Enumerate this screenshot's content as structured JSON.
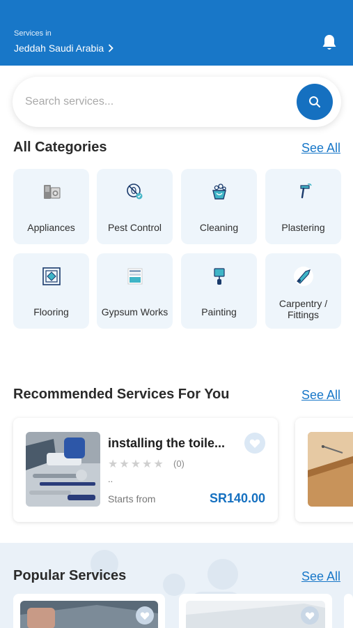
{
  "header": {
    "services_in_label": "Services in",
    "location": "Jeddah Saudi Arabia",
    "bell_icon": "bell-icon"
  },
  "search": {
    "placeholder": "Search services...",
    "button_icon": "search-icon"
  },
  "categories": {
    "title": "All Categories",
    "see_all": "See All",
    "items": [
      {
        "label": "Appliances",
        "icon": "appliances-icon"
      },
      {
        "label": "Pest Control",
        "icon": "pest-control-icon"
      },
      {
        "label": "Cleaning",
        "icon": "cleaning-icon"
      },
      {
        "label": "Plastering",
        "icon": "plastering-icon"
      },
      {
        "label": "Flooring",
        "icon": "flooring-icon"
      },
      {
        "label": "Gypsum Works",
        "icon": "gypsum-icon"
      },
      {
        "label": "Painting",
        "icon": "painting-icon"
      },
      {
        "label": "Carpentry / Fittings",
        "icon": "carpentry-icon"
      }
    ]
  },
  "recommended": {
    "title": "Recommended Services For You",
    "see_all": "See All",
    "cards": [
      {
        "title": "installing the toile...",
        "rating_count": "(0)",
        "rating": 0,
        "description": "..",
        "starts_from_label": "Starts from",
        "price": "SR140.00"
      }
    ]
  },
  "popular": {
    "title": "Popular Services",
    "see_all": "See All"
  },
  "colors": {
    "brand": "#1877c8",
    "price": "#1570c0",
    "category_bg": "#eef5fb"
  }
}
